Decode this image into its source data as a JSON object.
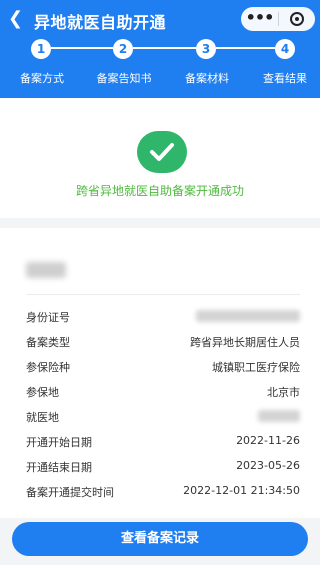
{
  "header": {
    "back_icon": "chevron-left-icon",
    "title": "异地就医自助开通",
    "menu_icon": "more-dots-icon",
    "close_icon": "target-circle-icon",
    "color": "#1f7ef0"
  },
  "steps": [
    {
      "number": "1",
      "label": "备案方式"
    },
    {
      "number": "2",
      "label": "备案告知书"
    },
    {
      "number": "3",
      "label": "备案材料"
    },
    {
      "number": "4",
      "label": "查看结果"
    }
  ],
  "result": {
    "icon": "check-circle-icon",
    "message": "跨省异地就医自助备案开通成功",
    "color": "#2fb66a"
  },
  "details": [
    {
      "label": "身份证号",
      "value": ""
    },
    {
      "label": "备案类型",
      "value": "跨省异地长期居住人员"
    },
    {
      "label": "参保险种",
      "value": "城镇职工医疗保险"
    },
    {
      "label": "参保地",
      "value": "北京市"
    },
    {
      "label": "就医地",
      "value": ""
    },
    {
      "label": "开通开始日期",
      "value": "2022-11-26"
    },
    {
      "label": "开通结束日期",
      "value": "2023-05-26"
    },
    {
      "label": "备案开通提交时间",
      "value": "2022-12-01 21:34:50"
    }
  ],
  "action": {
    "label": "查看备案记录"
  }
}
